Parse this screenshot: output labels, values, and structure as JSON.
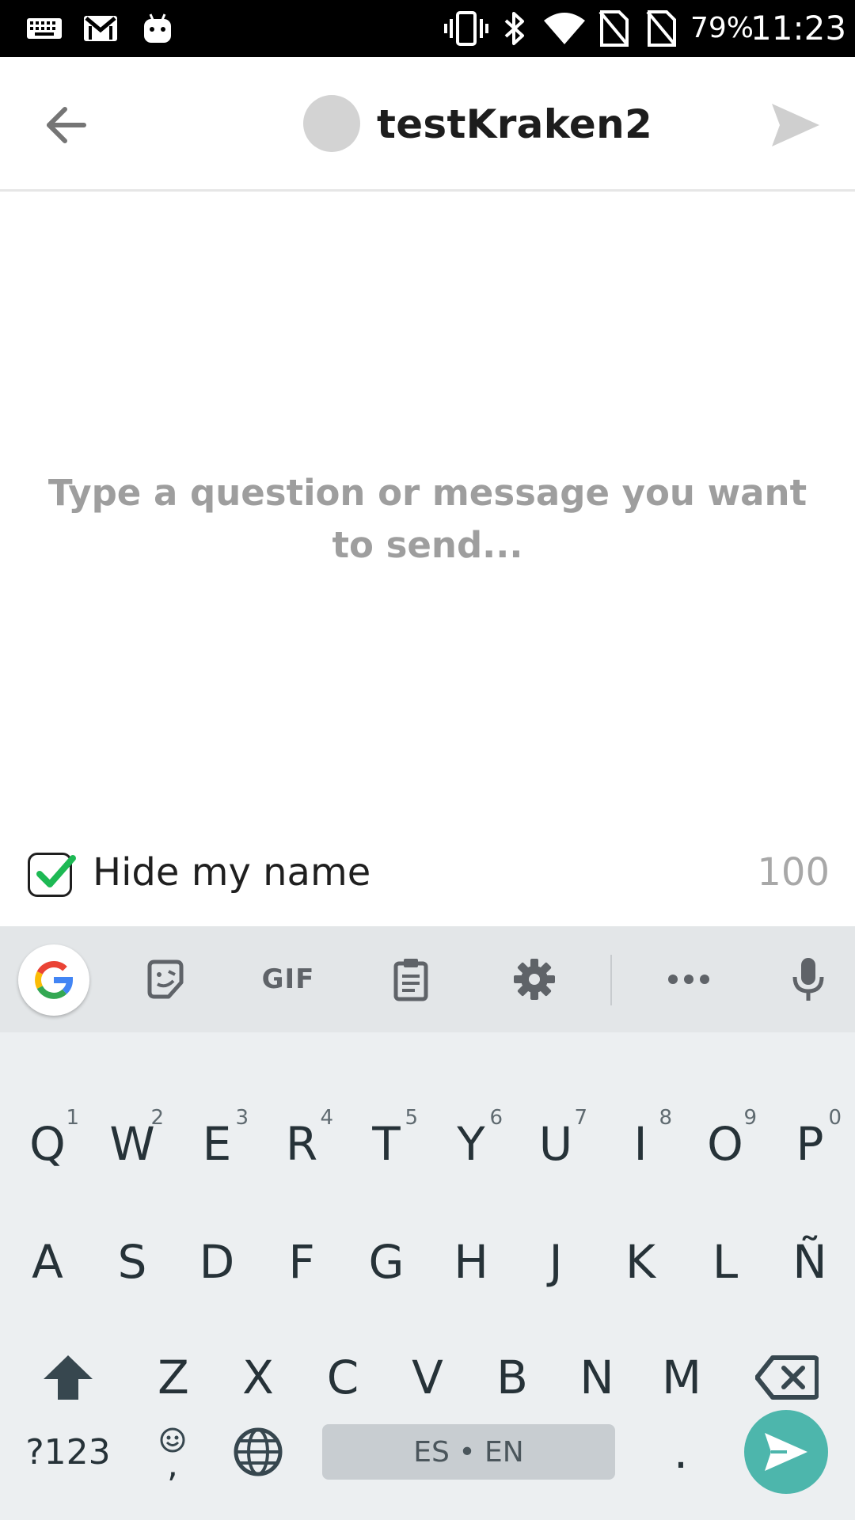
{
  "status_bar": {
    "battery": "79%",
    "time": "11:23",
    "left_icons": [
      "keyboard-icon",
      "gmail-icon",
      "android-icon"
    ],
    "right_icons": [
      "vibrate-icon",
      "bluetooth-icon",
      "wifi-icon",
      "no-sim-icon",
      "no-sim-icon"
    ]
  },
  "header": {
    "recipient": "testKraken2",
    "back_icon": "arrow-left-icon",
    "send_icon": "send-icon"
  },
  "compose": {
    "placeholder": "Type a question or message you want to send..."
  },
  "options": {
    "hide_name_label": "Hide my name",
    "hide_name_checked": true,
    "char_count": "100"
  },
  "keyboard": {
    "toolbar": {
      "gif_label": "GIF",
      "icons": [
        "google-icon",
        "sticker-icon",
        "gif-icon",
        "clipboard-icon",
        "settings-icon",
        "more-icon",
        "mic-icon"
      ]
    },
    "row1": [
      {
        "key": "Q",
        "hint": "1"
      },
      {
        "key": "W",
        "hint": "2"
      },
      {
        "key": "E",
        "hint": "3"
      },
      {
        "key": "R",
        "hint": "4"
      },
      {
        "key": "T",
        "hint": "5"
      },
      {
        "key": "Y",
        "hint": "6"
      },
      {
        "key": "U",
        "hint": "7"
      },
      {
        "key": "I",
        "hint": "8"
      },
      {
        "key": "O",
        "hint": "9"
      },
      {
        "key": "P",
        "hint": "0"
      }
    ],
    "row2": [
      "A",
      "S",
      "D",
      "F",
      "G",
      "H",
      "J",
      "K",
      "L",
      "Ñ"
    ],
    "row3": [
      "Z",
      "X",
      "C",
      "V",
      "B",
      "N",
      "M"
    ],
    "symbols_label": "?123",
    "comma_label": ",",
    "space_label": "ES • EN",
    "period_label": ".",
    "colors": {
      "enter_accent": "#4db6ac",
      "check_accent": "#1db954"
    }
  }
}
